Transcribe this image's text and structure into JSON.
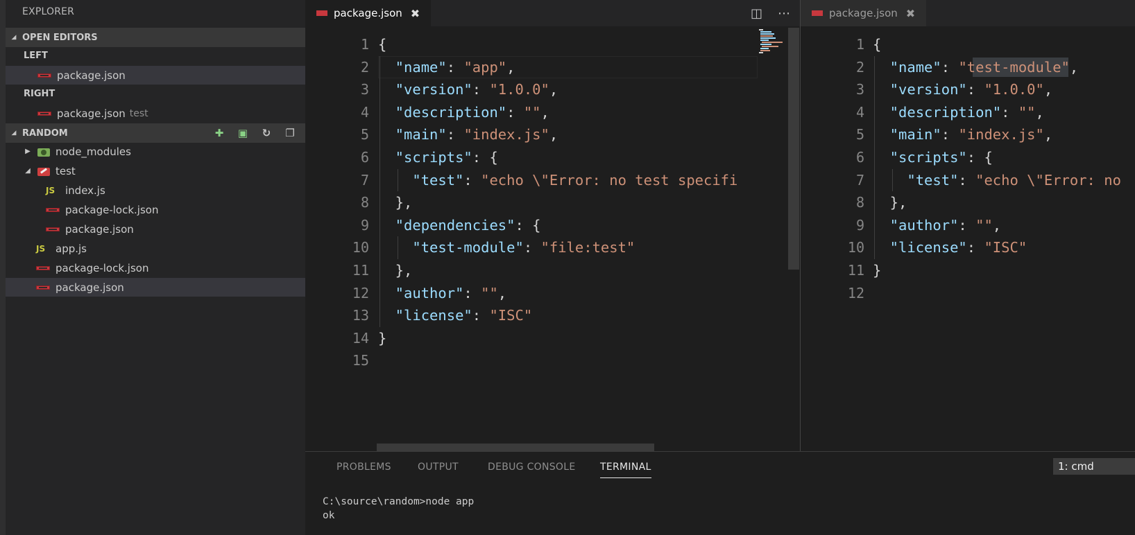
{
  "sidebar": {
    "title": "EXPLORER",
    "open_editors": {
      "header": "OPEN EDITORS",
      "groups": [
        {
          "label": "LEFT",
          "files": [
            {
              "name": "package.json",
              "desc": ""
            }
          ]
        },
        {
          "label": "RIGHT",
          "files": [
            {
              "name": "package.json",
              "desc": "test"
            }
          ]
        }
      ]
    },
    "folder": {
      "header": "RANDOM",
      "items": [
        {
          "name": "node_modules",
          "kind": "folder-collapsed"
        },
        {
          "name": "test",
          "kind": "folder-expanded"
        },
        {
          "name": "index.js",
          "kind": "js"
        },
        {
          "name": "package-lock.json",
          "kind": "npm"
        },
        {
          "name": "package.json",
          "kind": "npm"
        },
        {
          "name": "app.js",
          "kind": "js"
        },
        {
          "name": "package-lock.json",
          "kind": "npm"
        },
        {
          "name": "package.json",
          "kind": "npm"
        }
      ]
    },
    "js_badge": "JS"
  },
  "editor_left": {
    "tab": "package.json",
    "line_numbers": [
      "1",
      "2",
      "3",
      "4",
      "5",
      "6",
      "7",
      "8",
      "9",
      "10",
      "11",
      "12",
      "13",
      "14",
      "15"
    ],
    "lines": [
      [
        [
          "p",
          "{"
        ]
      ],
      [
        [
          "k",
          "  \"name\""
        ],
        [
          "p",
          ": "
        ],
        [
          "s",
          "\"app\""
        ],
        [
          "p",
          ","
        ]
      ],
      [
        [
          "k",
          "  \"version\""
        ],
        [
          "p",
          ": "
        ],
        [
          "s",
          "\"1.0.0\""
        ],
        [
          "p",
          ","
        ]
      ],
      [
        [
          "k",
          "  \"description\""
        ],
        [
          "p",
          ": "
        ],
        [
          "s",
          "\"\""
        ],
        [
          "p",
          ","
        ]
      ],
      [
        [
          "k",
          "  \"main\""
        ],
        [
          "p",
          ": "
        ],
        [
          "s",
          "\"index.js\""
        ],
        [
          "p",
          ","
        ]
      ],
      [
        [
          "k",
          "  \"scripts\""
        ],
        [
          "p",
          ": {"
        ]
      ],
      [
        [
          "k",
          "    \"test\""
        ],
        [
          "p",
          ": "
        ],
        [
          "s",
          "\"echo \\\"Error: no test specifi"
        ]
      ],
      [
        [
          "p",
          "  },"
        ]
      ],
      [
        [
          "k",
          "  \"dependencies\""
        ],
        [
          "p",
          ": {"
        ]
      ],
      [
        [
          "k",
          "    \"test-module\""
        ],
        [
          "p",
          ": "
        ],
        [
          "s",
          "\"file:test\""
        ]
      ],
      [
        [
          "p",
          "  },"
        ]
      ],
      [
        [
          "k",
          "  \"author\""
        ],
        [
          "p",
          ": "
        ],
        [
          "s",
          "\"\""
        ],
        [
          "p",
          ","
        ]
      ],
      [
        [
          "k",
          "  \"license\""
        ],
        [
          "p",
          ": "
        ],
        [
          "s",
          "\"ISC\""
        ]
      ],
      [
        [
          "p",
          "}"
        ]
      ],
      []
    ]
  },
  "editor_right": {
    "tab": "package.json",
    "line_numbers": [
      "1",
      "2",
      "3",
      "4",
      "5",
      "6",
      "7",
      "8",
      "9",
      "10",
      "11",
      "12"
    ],
    "lines": [
      [
        [
          "p",
          "{"
        ]
      ],
      [
        [
          "k",
          "  \"name\""
        ],
        [
          "p",
          ": "
        ],
        [
          "s",
          "\"test-module\""
        ],
        [
          "p",
          ","
        ]
      ],
      [
        [
          "k",
          "  \"version\""
        ],
        [
          "p",
          ": "
        ],
        [
          "s",
          "\"1.0.0\""
        ],
        [
          "p",
          ","
        ]
      ],
      [
        [
          "k",
          "  \"description\""
        ],
        [
          "p",
          ": "
        ],
        [
          "s",
          "\"\""
        ],
        [
          "p",
          ","
        ]
      ],
      [
        [
          "k",
          "  \"main\""
        ],
        [
          "p",
          ": "
        ],
        [
          "s",
          "\"index.js\""
        ],
        [
          "p",
          ","
        ]
      ],
      [
        [
          "k",
          "  \"scripts\""
        ],
        [
          "p",
          ": {"
        ]
      ],
      [
        [
          "k",
          "    \"test\""
        ],
        [
          "p",
          ": "
        ],
        [
          "s",
          "\"echo \\\"Error: no"
        ]
      ],
      [
        [
          "p",
          "  },"
        ]
      ],
      [
        [
          "k",
          "  \"author\""
        ],
        [
          "p",
          ": "
        ],
        [
          "s",
          "\"\""
        ],
        [
          "p",
          ","
        ]
      ],
      [
        [
          "k",
          "  \"license\""
        ],
        [
          "p",
          ": "
        ],
        [
          "s",
          "\"ISC\""
        ]
      ],
      [
        [
          "p",
          "}"
        ]
      ],
      []
    ]
  },
  "panel": {
    "tabs": [
      "PROBLEMS",
      "OUTPUT",
      "DEBUG CONSOLE",
      "TERMINAL"
    ],
    "active_tab": "TERMINAL",
    "terminal_select": "1: cmd",
    "terminal_lines": [
      "C:\\source\\random>node app",
      "ok"
    ]
  },
  "colors": {
    "key": "#9cdcfe",
    "string": "#ce9178",
    "punct": "#d4d4d4",
    "npm_icon": "#c8383e",
    "js_icon": "#cbcb41"
  },
  "icons": {
    "new_file": "new-file-icon",
    "new_folder": "new-folder-icon",
    "refresh": "refresh-icon",
    "collapse": "collapse-all-icon",
    "split": "split-editor-icon",
    "more": "more-actions-icon",
    "close": "close-icon"
  }
}
